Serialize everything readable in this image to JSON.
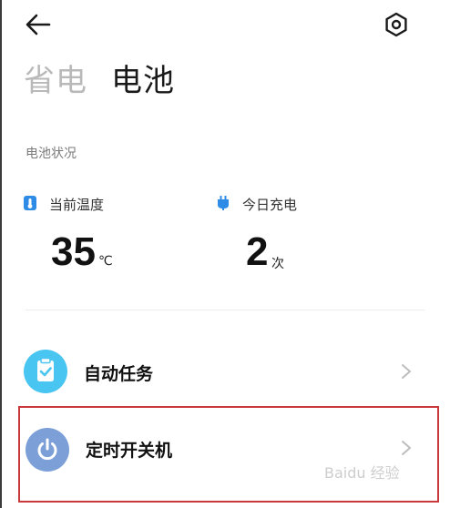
{
  "header": {
    "back_icon": "arrow-left-icon",
    "settings_icon": "hexagon-gear-icon"
  },
  "tabs": [
    {
      "label": "省电",
      "active": false
    },
    {
      "label": "电池",
      "active": true
    }
  ],
  "battery_status": {
    "section_title": "电池状况",
    "temperature": {
      "icon": "thermometer-icon",
      "label": "当前温度",
      "value": "35",
      "unit": "℃"
    },
    "charges_today": {
      "icon": "charging-plug-icon",
      "label": "今日充电",
      "value": "2",
      "unit": "次"
    }
  },
  "list": [
    {
      "label": "自动任务",
      "icon": "clipboard-check-icon",
      "icon_color": "#48c5f0",
      "highlighted": false
    },
    {
      "label": "定时开关机",
      "icon": "power-icon",
      "icon_color": "#7c9fd8",
      "highlighted": true
    }
  ],
  "colors": {
    "highlight_border": "#c9383a",
    "stat_icon": "#2e8be6"
  },
  "watermark": "Baidu 经验"
}
